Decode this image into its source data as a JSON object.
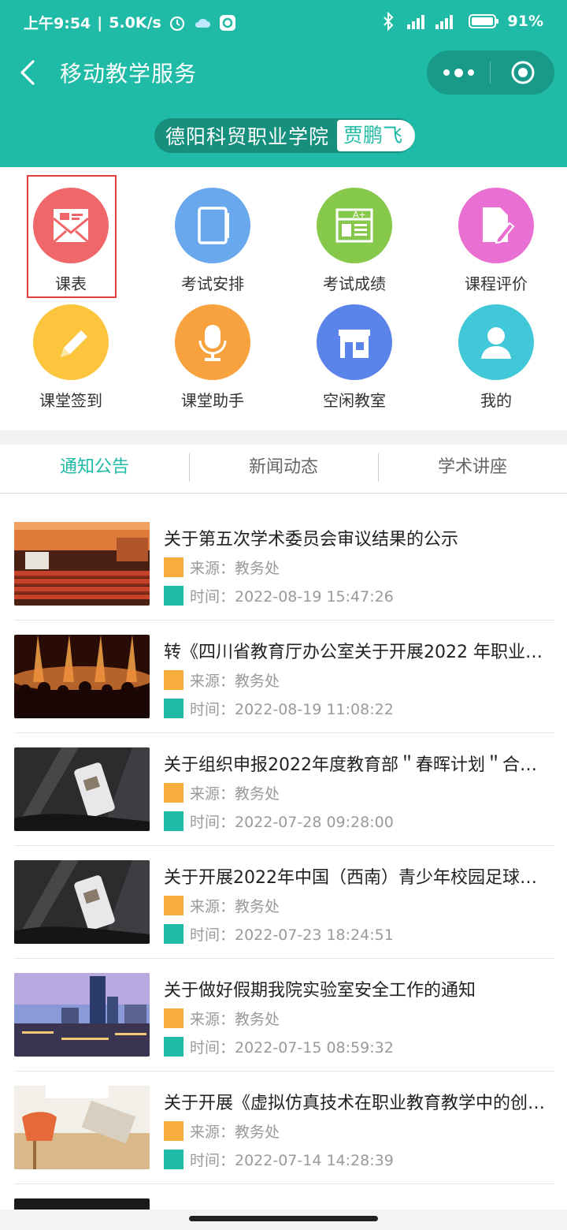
{
  "status_bar": {
    "time": "上午9:54",
    "speed": "5.0K/s",
    "battery": "91%",
    "icons": [
      "alarm-icon",
      "weather-icon",
      "app-icon",
      "bluetooth-icon",
      "signal-icon",
      "battery-icon"
    ]
  },
  "navbar": {
    "title": "移动教学服务"
  },
  "profile": {
    "school": "德阳科贸职业学院",
    "student": "贾鹏飞"
  },
  "grid": [
    {
      "label": "课表",
      "icon": "envelope-icon",
      "color": "#f0676a"
    },
    {
      "label": "考试安排",
      "icon": "notebook-icon",
      "color": "#6aa8ee"
    },
    {
      "label": "考试成绩",
      "icon": "grade-sheet-icon",
      "color": "#86c84a"
    },
    {
      "label": "课程评价",
      "icon": "document-pen-icon",
      "color": "#ea6fd3"
    },
    {
      "label": "课堂签到",
      "icon": "pencil-icon",
      "color": "#fcc53d"
    },
    {
      "label": "课堂助手",
      "icon": "microphone-icon",
      "color": "#f7a23e"
    },
    {
      "label": "空闲教室",
      "icon": "classroom-icon",
      "color": "#5a84ea"
    },
    {
      "label": "我的",
      "icon": "person-icon",
      "color": "#40c8d8"
    }
  ],
  "tabs": [
    {
      "label": "通知公告",
      "active": true
    },
    {
      "label": "新闻动态",
      "active": false
    },
    {
      "label": "学术讲座",
      "active": false
    }
  ],
  "news": [
    {
      "title": "关于第五次学术委员会审议结果的公示",
      "source": "来源：教务处",
      "time": "时间：2022-08-19 15:47:26",
      "thumb": "auditorium"
    },
    {
      "title": "转《四川省教育厅办公室关于开展2022 年职业…",
      "source": "来源：教务处",
      "time": "时间：2022-08-19 11:08:22",
      "thumb": "concert"
    },
    {
      "title": "关于组织申报2022年度教育部＂春晖计划＂合…",
      "source": "来源：教务处",
      "time": "时间：2022-07-28 09:28:00",
      "thumb": "phone"
    },
    {
      "title": "关于开展2022年中国（西南）青少年校园足球…",
      "source": "来源：教务处",
      "time": "时间：2022-07-23 18:24:51",
      "thumb": "phone"
    },
    {
      "title": "关于做好假期我院实验室安全工作的通知",
      "source": "来源：教务处",
      "time": "时间：2022-07-15 08:59:32",
      "thumb": "city"
    },
    {
      "title": "关于开展《虚拟仿真技术在职业教育教学中的创…",
      "source": "来源：教务处",
      "time": "时间：2022-07-14 14:28:39",
      "thumb": "desk"
    }
  ]
}
